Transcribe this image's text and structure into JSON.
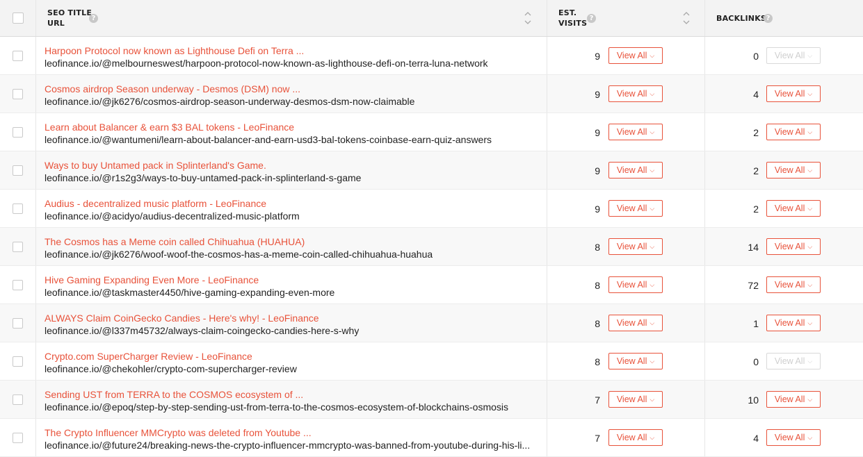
{
  "header": {
    "seo_title": "SEO TITLE",
    "url": "URL",
    "est": "EST.",
    "visits": "VISITS",
    "backlinks": "BACKLINKS",
    "help_glyph": "?"
  },
  "view_all_label": "View All",
  "rows": [
    {
      "title": "Harpoon Protocol now known as Lighthouse Defi on Terra ...",
      "url": "leofinance.io/@melbourneswest/harpoon-protocol-now-known-as-lighthouse-defi-on-terra-luna-network",
      "visits": "9",
      "backlinks": "0",
      "backlinks_view_enabled": false
    },
    {
      "title": "Cosmos airdrop Season underway - Desmos (DSM) now ...",
      "url": "leofinance.io/@jk6276/cosmos-airdrop-season-underway-desmos-dsm-now-claimable",
      "visits": "9",
      "backlinks": "4",
      "backlinks_view_enabled": true
    },
    {
      "title": "Learn about Balancer & earn $3 BAL tokens - LeoFinance",
      "url": "leofinance.io/@wantumeni/learn-about-balancer-and-earn-usd3-bal-tokens-coinbase-earn-quiz-answers",
      "visits": "9",
      "backlinks": "2",
      "backlinks_view_enabled": true
    },
    {
      "title": "Ways to buy Untamed pack in Splinterland's Game.",
      "url": "leofinance.io/@r1s2g3/ways-to-buy-untamed-pack-in-splinterland-s-game",
      "visits": "9",
      "backlinks": "2",
      "backlinks_view_enabled": true
    },
    {
      "title": "Audius - decentralized music platform - LeoFinance",
      "url": "leofinance.io/@acidyo/audius-decentralized-music-platform",
      "visits": "9",
      "backlinks": "2",
      "backlinks_view_enabled": true
    },
    {
      "title": "The Cosmos has a Meme coin called Chihuahua (HUAHUA)",
      "url": "leofinance.io/@jk6276/woof-woof-the-cosmos-has-a-meme-coin-called-chihuahua-huahua",
      "visits": "8",
      "backlinks": "14",
      "backlinks_view_enabled": true
    },
    {
      "title": "Hive Gaming Expanding Even More - LeoFinance",
      "url": "leofinance.io/@taskmaster4450/hive-gaming-expanding-even-more",
      "visits": "8",
      "backlinks": "72",
      "backlinks_view_enabled": true
    },
    {
      "title": "ALWAYS Claim CoinGecko Candies - Here's why! - LeoFinance",
      "url": "leofinance.io/@l337m45732/always-claim-coingecko-candies-here-s-why",
      "visits": "8",
      "backlinks": "1",
      "backlinks_view_enabled": true
    },
    {
      "title": "Crypto.com SuperCharger Review - LeoFinance",
      "url": "leofinance.io/@chekohler/crypto-com-supercharger-review",
      "visits": "8",
      "backlinks": "0",
      "backlinks_view_enabled": false
    },
    {
      "title": "Sending UST from TERRA to the COSMOS ecosystem of ...",
      "url": "leofinance.io/@epoq/step-by-step-sending-ust-from-terra-to-the-cosmos-ecosystem-of-blockchains-osmosis",
      "visits": "7",
      "backlinks": "10",
      "backlinks_view_enabled": true
    },
    {
      "title": "The Crypto Influencer MMCrypto was deleted from Youtube ...",
      "url": "leofinance.io/@future24/breaking-news-the-crypto-influencer-mmcrypto-was-banned-from-youtube-during-his-li...",
      "visits": "7",
      "backlinks": "4",
      "backlinks_view_enabled": true
    }
  ],
  "colors": {
    "accent": "#e8523a",
    "disabled": "#d9d9d9",
    "header_bg": "#f3f3f3",
    "alt_row_bg": "#f8f8f8"
  },
  "icons": {
    "help": "help-circle-icon",
    "sort": "sort-arrows-icon",
    "dropdown": "chevron-down-icon"
  }
}
